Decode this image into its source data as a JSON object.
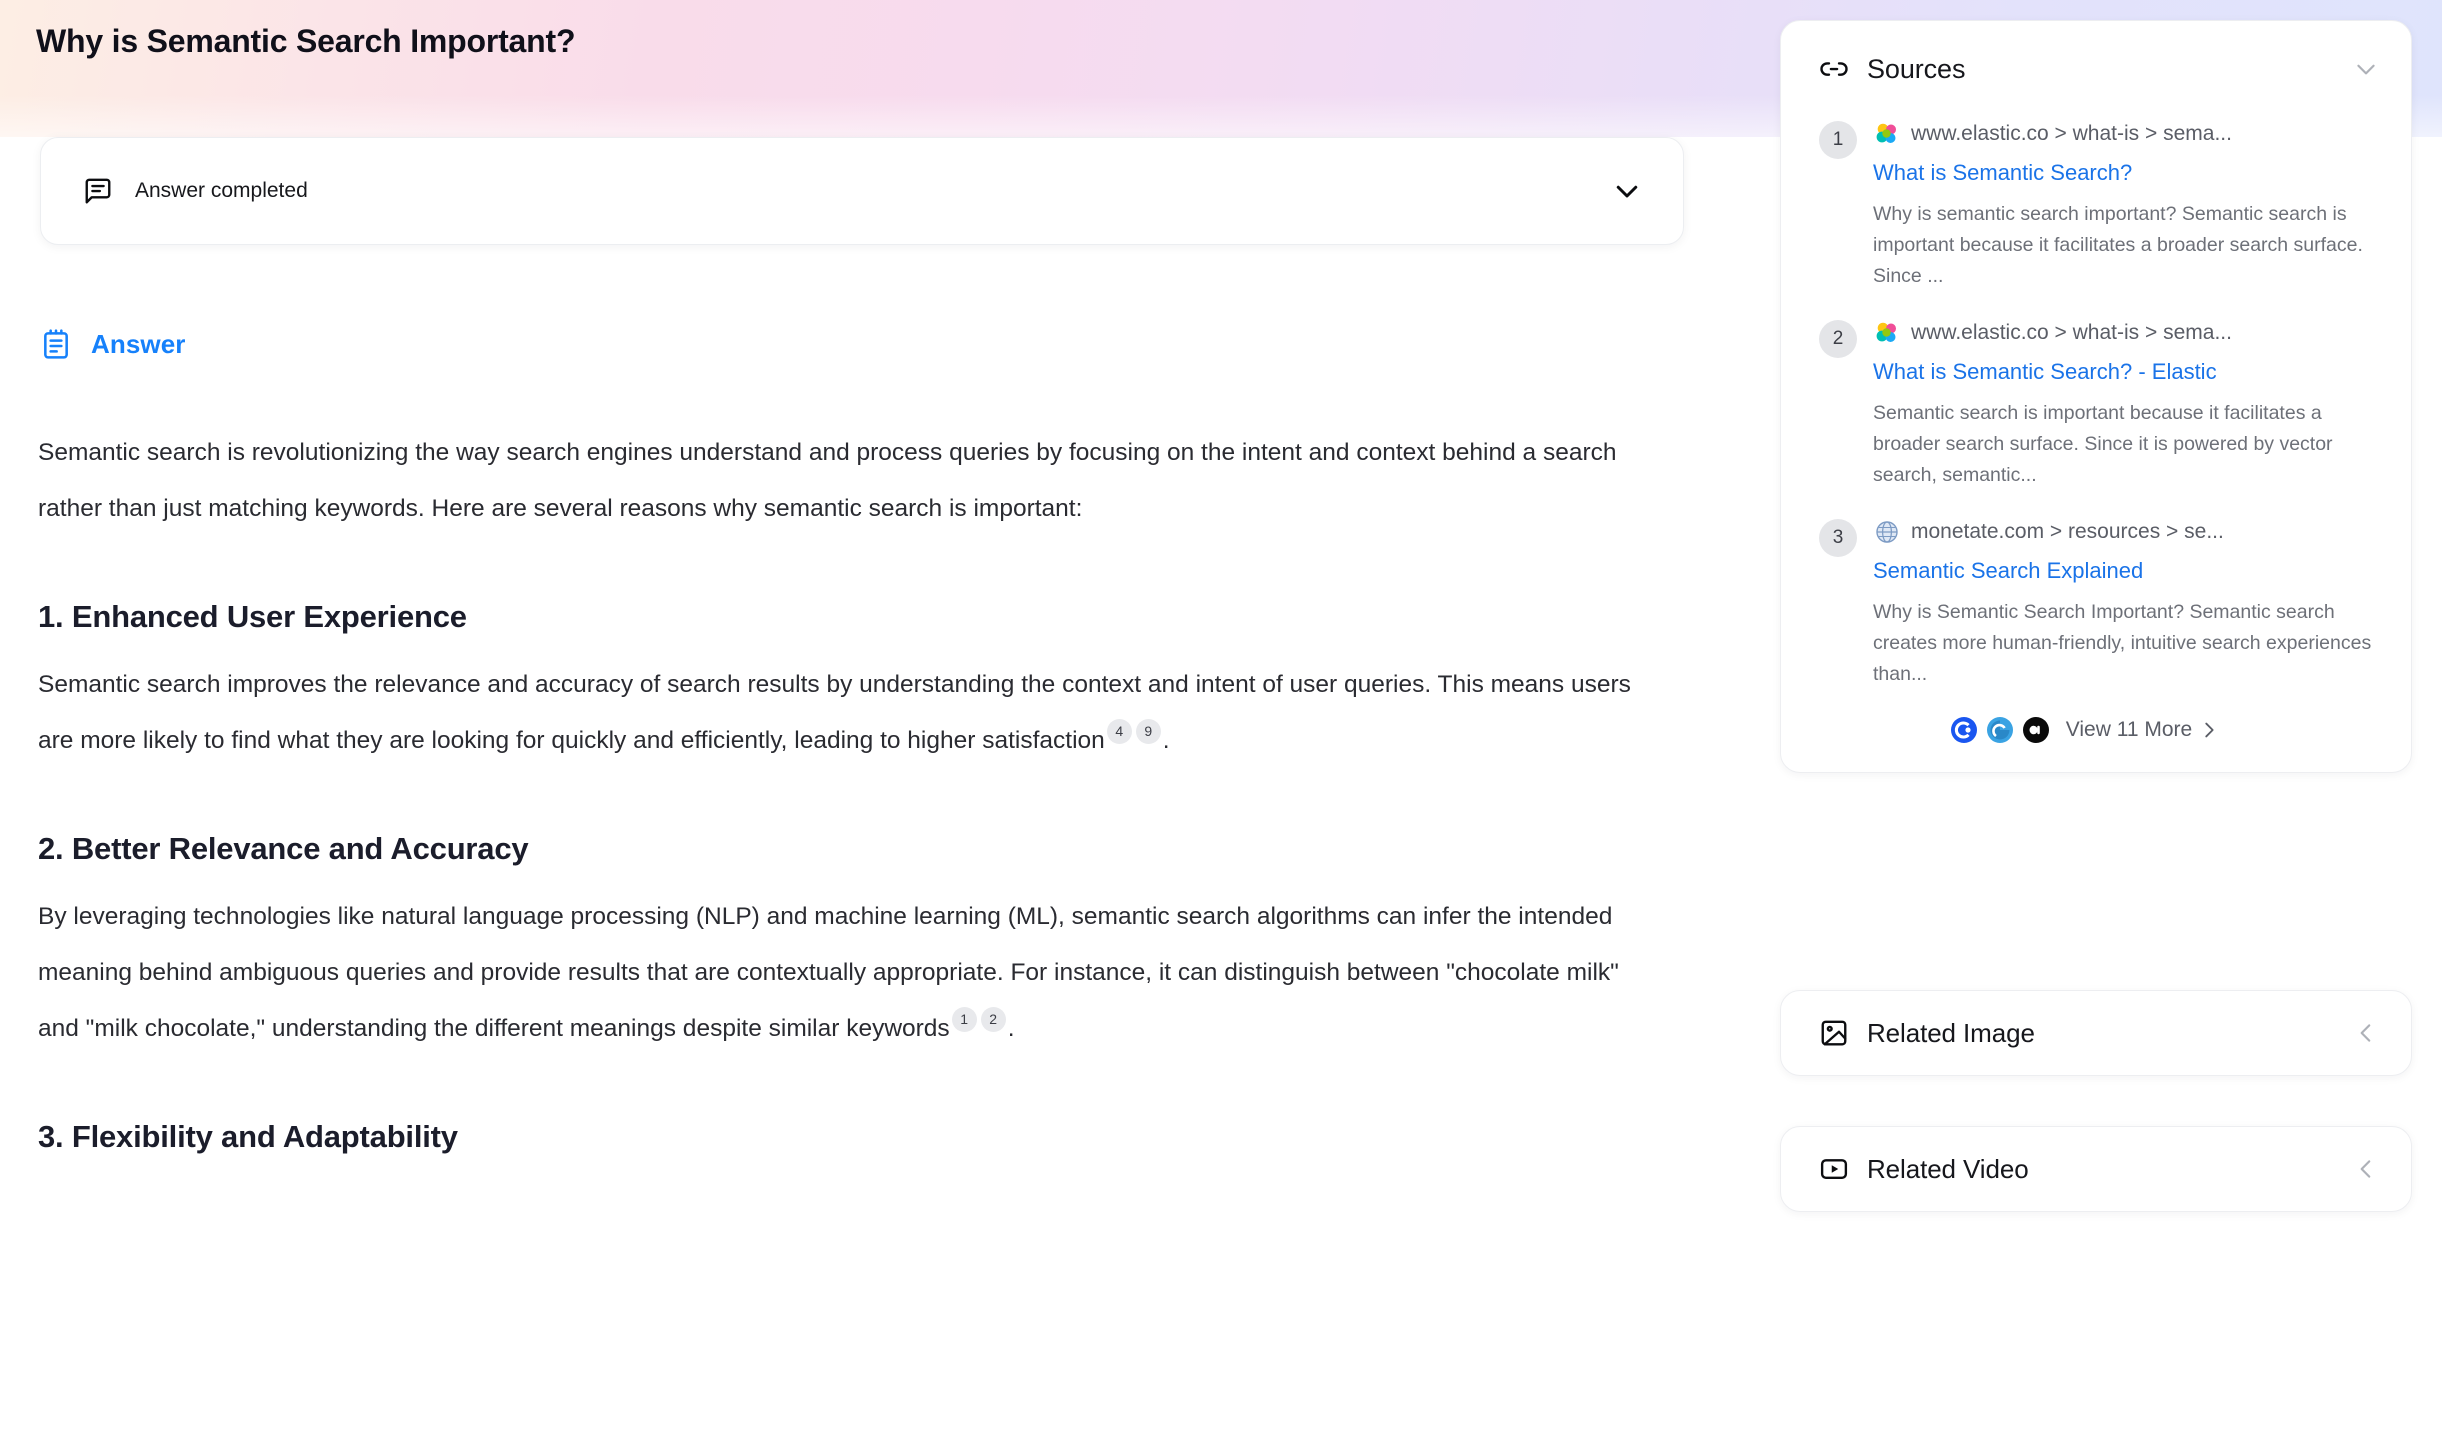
{
  "page": {
    "title": "Why is Semantic Search Important?"
  },
  "status": {
    "label": "Answer completed",
    "icon": "message-square-text-icon",
    "toggle_icon": "chevron-down-icon"
  },
  "answer": {
    "heading": "Answer",
    "icon": "notepad-icon",
    "accent_color": "#1681fb",
    "intro": "Semantic search is revolutionizing the way search engines understand and process queries by focusing on the intent and context behind a search rather than just matching keywords. Here are several reasons why semantic search is important:",
    "sections": [
      {
        "heading": "1. Enhanced User Experience",
        "body_before": "Semantic search improves the relevance and accuracy of search results by understanding the context and intent of user queries. This means users are more likely to find what they are looking for quickly and efficiently, leading to higher satisfaction",
        "citations": [
          "4",
          "9"
        ],
        "body_after": "."
      },
      {
        "heading": "2. Better Relevance and Accuracy",
        "body_before": "By leveraging technologies like natural language processing (NLP) and machine learning (ML), semantic search algorithms can infer the intended meaning behind ambiguous queries and provide results that are contextually appropriate. For instance, it can distinguish between \"chocolate milk\" and \"milk chocolate,\" understanding the different meanings despite similar keywords",
        "citations": [
          "1",
          "2"
        ],
        "body_after": "."
      },
      {
        "heading": "3. Flexibility and Adaptability",
        "body_before": "",
        "citations": [],
        "body_after": ""
      }
    ]
  },
  "sidebar": {
    "sources": {
      "title": "Sources",
      "icon": "link-icon",
      "collapse_icon": "chevron-down-icon",
      "items": [
        {
          "number": "1",
          "favicon": "elastic-favicon",
          "domain": "www.elastic.co > what-is > sema...",
          "title": "What is Semantic Search?",
          "snippet": "Why is semantic search important? Semantic search is important because it facilitates a broader search surface. Since ..."
        },
        {
          "number": "2",
          "favicon": "elastic-favicon",
          "domain": "www.elastic.co > what-is > sema...",
          "title": "What is Semantic Search? - Elastic",
          "snippet": "Semantic search is important because it facilitates a broader search surface. Since it is powered by vector search, semantic..."
        },
        {
          "number": "3",
          "favicon": "globe-favicon",
          "domain": "monetate.com > resources > se...",
          "title": "Semantic Search Explained",
          "snippet": "Why is Semantic Search Important? Semantic search creates more human-friendly, intuitive search experiences than..."
        }
      ],
      "more": {
        "label": "View 11 More",
        "chevron_icon": "chevron-right-icon",
        "favicons": [
          "coveo-favicon",
          "algolia-favicon",
          "oracle-favicon"
        ]
      }
    },
    "related_image": {
      "title": "Related Image",
      "icon": "image-icon",
      "expand_icon": "chevron-left-icon"
    },
    "related_video": {
      "title": "Related Video",
      "icon": "video-play-icon",
      "expand_icon": "chevron-left-icon"
    }
  },
  "colors": {
    "link_blue": "#1a73e8",
    "accent_blue": "#1681fb",
    "citation_bg": "#e8e9ec",
    "gradient_left": "#fdeee4",
    "gradient_mid": "#f9dcea",
    "gradient_right": "#dfe4fc"
  }
}
